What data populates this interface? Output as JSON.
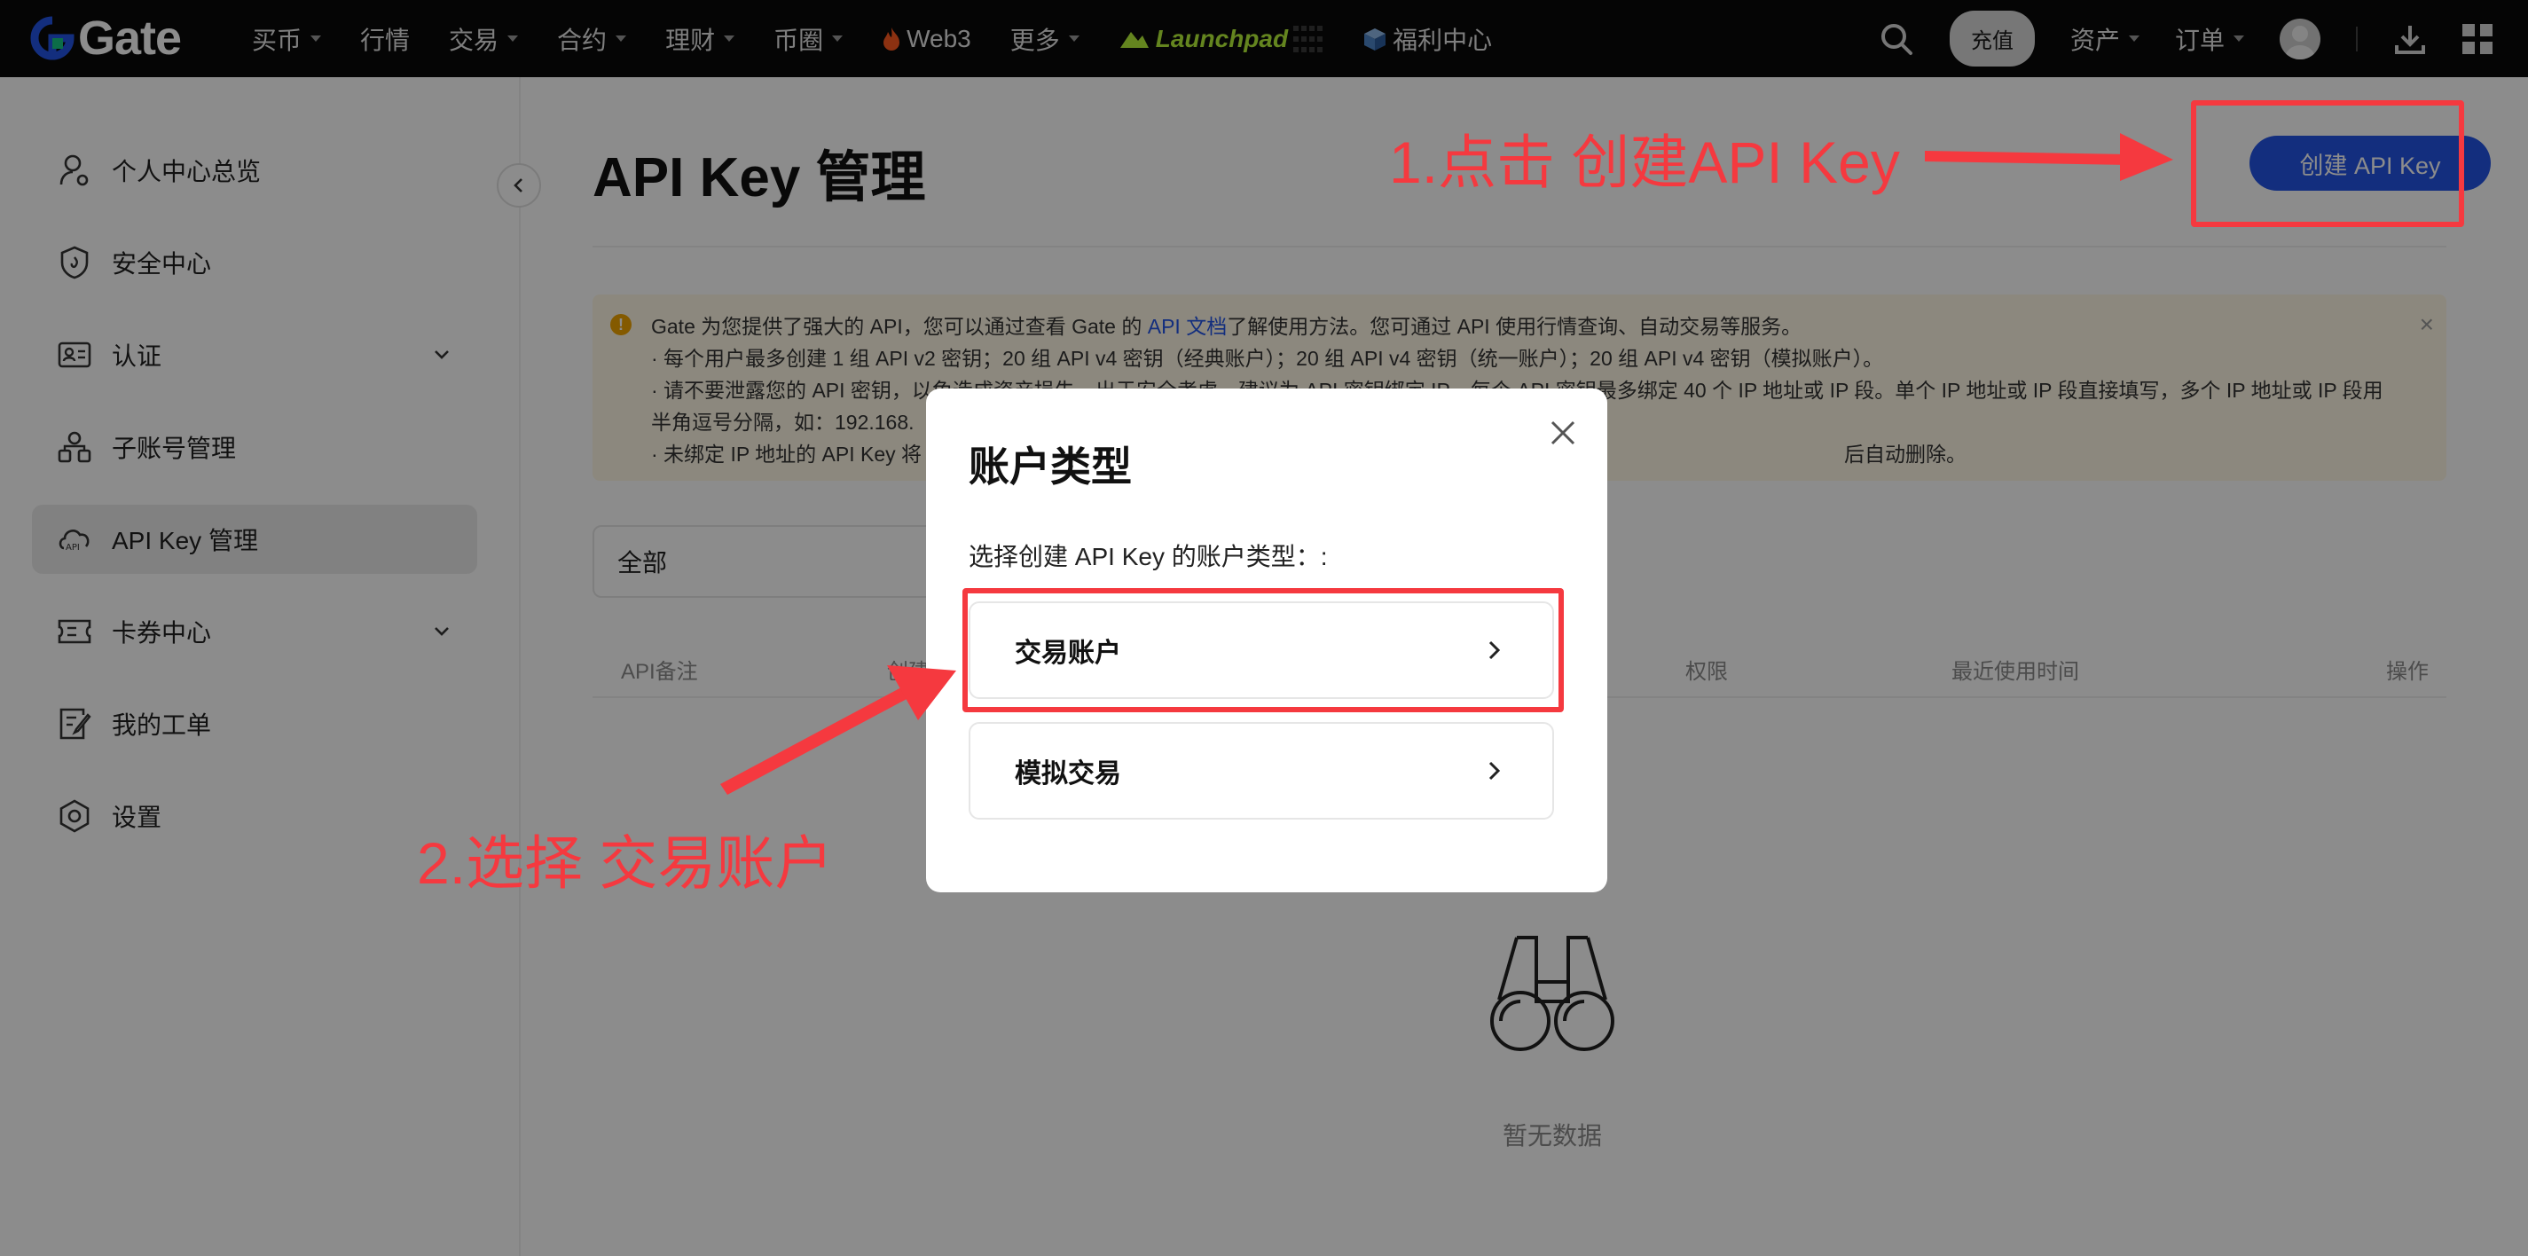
{
  "brand": {
    "name": "Gate"
  },
  "topnav": {
    "items": [
      {
        "label": "买币",
        "has_caret": true
      },
      {
        "label": "行情",
        "has_caret": false
      },
      {
        "label": "交易",
        "has_caret": true
      },
      {
        "label": "合约",
        "has_caret": true
      },
      {
        "label": "理财",
        "has_caret": true
      },
      {
        "label": "币圈",
        "has_caret": true
      },
      {
        "label": "Web3",
        "has_caret": false,
        "icon": "flame-icon"
      },
      {
        "label": "更多",
        "has_caret": true
      },
      {
        "label": "Launchpad",
        "has_caret": false,
        "icon": "launchpad-icon"
      },
      {
        "label": "福利中心",
        "has_caret": false,
        "icon": "gift-box-icon"
      }
    ],
    "recharge_label": "充值",
    "assets_label": "资产",
    "orders_label": "订单"
  },
  "sidebar": {
    "items": [
      {
        "label": "个人中心总览",
        "icon": "user-icon",
        "expandable": false,
        "active": false
      },
      {
        "label": "安全中心",
        "icon": "shield-icon",
        "expandable": false,
        "active": false
      },
      {
        "label": "认证",
        "icon": "id-card-icon",
        "expandable": true,
        "active": false
      },
      {
        "label": "子账号管理",
        "icon": "sub-accounts-icon",
        "expandable": false,
        "active": false
      },
      {
        "label": "API Key 管理",
        "icon": "api-icon",
        "expandable": false,
        "active": true
      },
      {
        "label": "卡券中心",
        "icon": "coupon-icon",
        "expandable": true,
        "active": false
      },
      {
        "label": "我的工单",
        "icon": "ticket-icon",
        "expandable": false,
        "active": false
      },
      {
        "label": "设置",
        "icon": "settings-icon",
        "expandable": false,
        "active": false
      }
    ]
  },
  "main": {
    "title": "API Key 管理",
    "create_button": "创建 API Key",
    "notice": {
      "line1_a": "Gate 为您提供了强大的 API，您可以通过查看 Gate 的 ",
      "line1_link": "API 文档",
      "line1_b": "了解使用方法。您可通过 API 使用行情查询、自动交易等服务。",
      "line2": "· 每个用户最多创建 1 组 API v2 密钥；20 组 API v4 密钥（经典账户）；20 组 API v4 密钥（统一账户）；20 组 API v4 密钥（模拟账户）。",
      "line3": "· 请不要泄露您的 API 密钥，以免造成资产损失。出于安全考虑，建议为 API 密钥绑定 IP，每个 API 密钥最多绑定 40 个 IP 地址或 IP 段。单个 IP 地址或 IP 段直接填写，多个 IP 地址或 IP 段用",
      "line4": "半角逗号分隔，如：192.168.",
      "line5_a": "· 未绑定 IP 地址的 API Key 将",
      "line5_b": "后自动删除。"
    },
    "filter_value": "全部",
    "table_headers": [
      "API备注",
      "创建",
      "权限",
      "最近使用时间",
      "操作"
    ],
    "empty_text": "暂无数据"
  },
  "modal": {
    "title": "账户类型",
    "subtitle": "选择创建 API Key 的账户类型：:",
    "options": [
      {
        "label": "交易账户"
      },
      {
        "label": "模拟交易"
      }
    ]
  },
  "annotations": {
    "step1": "1.点击 创建API Key",
    "step2": "2.选择 交易账户",
    "color": "#f5393f"
  },
  "colors": {
    "primary": "#2354e6",
    "topbar": "#0a0a0a",
    "notice_bg": "#fff8e6",
    "annotation": "#f5393f"
  }
}
